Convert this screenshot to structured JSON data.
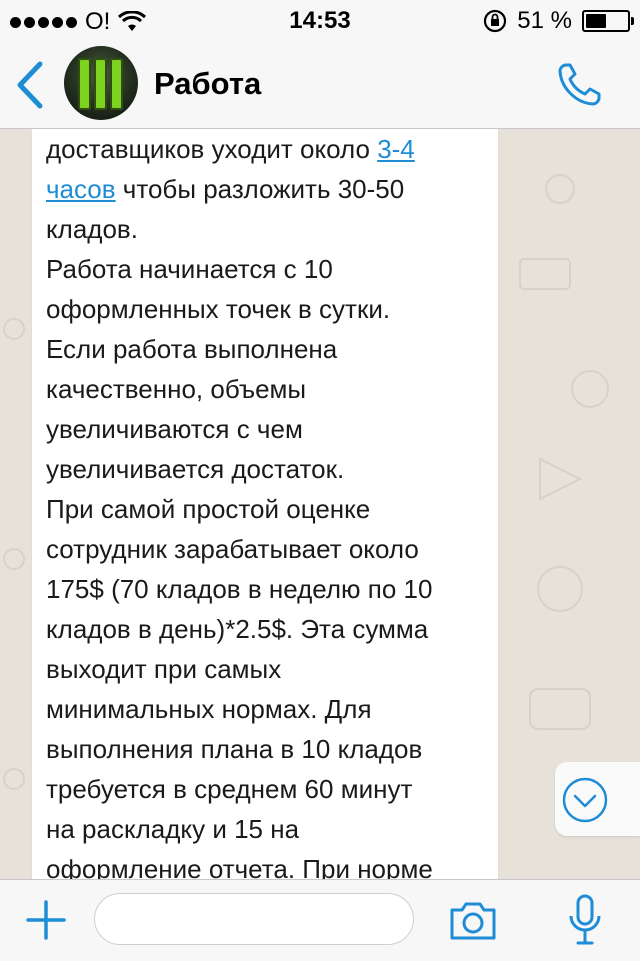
{
  "status_bar": {
    "carrier": "O!",
    "time": "14:53",
    "battery_percent": "51 %",
    "battery_level": 0.51
  },
  "header": {
    "chat_title": "Работа"
  },
  "message": {
    "lines_before_link": "доставщиков уходит около ",
    "link_text": "3-4\nчасов",
    "lines_after_link": " чтобы разложить 30-50\nкладов.\nРабота начинается с 10\nоформленных точек в сутки.\nЕсли работа выполнена\nкачественно, объемы\nувеличиваются с чем\nувеличивается достаток.\nПри самой простой оценке\nсотрудник зарабатывает около\n175$ (70 кладов в неделю по 10\nкладов в день)*2.5$. Эта сумма\nвыходит при самых\nминимальных нормах. Для\nвыполнения плана в 10 кладов\nтребуется в среднем 60 минут\nна раскладку и 15 на\nоформление отчета. При норме"
  },
  "input_bar": {
    "message_value": "",
    "message_placeholder": ""
  },
  "colors": {
    "accent": "#1e8dd6",
    "chat_background": "#e6e2d9"
  },
  "icons": [
    "signal-dots-icon",
    "wifi-icon",
    "rotation-lock-icon",
    "battery-icon",
    "back-chevron-icon",
    "phone-icon",
    "chevron-down-circle-icon",
    "plus-icon",
    "camera-icon",
    "microphone-icon"
  ]
}
